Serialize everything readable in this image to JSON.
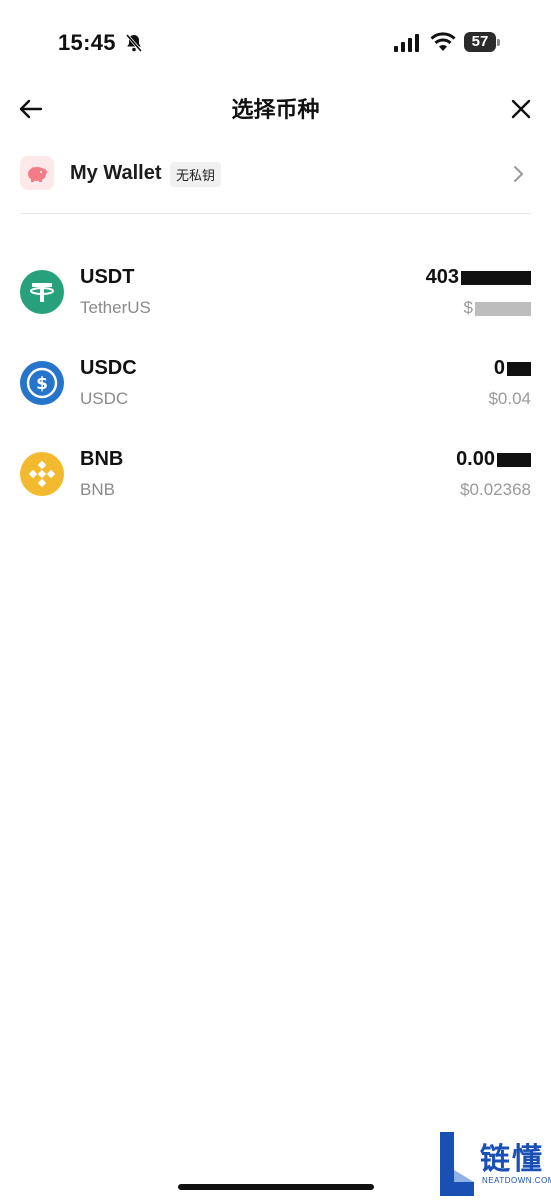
{
  "status_bar": {
    "time": "15:45",
    "battery": "57",
    "icons": [
      "bell-slash-icon",
      "signal-icon",
      "wifi-icon",
      "battery-icon"
    ]
  },
  "nav": {
    "title": "选择币种",
    "back_icon": "arrow-left-icon",
    "close_icon": "close-icon"
  },
  "wallet": {
    "name": "My Wallet",
    "badge": "无私钥",
    "icon": "piggy-bank-icon",
    "accent": "#f47c86"
  },
  "tokens": [
    {
      "symbol": "USDT",
      "name": "TetherUS",
      "balance": "403",
      "usd_value": "$",
      "color": "#26a17b",
      "icon": "tether-icon"
    },
    {
      "symbol": "USDC",
      "name": "USDC",
      "balance": "0",
      "usd_value": "$0.04",
      "color": "#2775ca",
      "icon": "usdc-icon"
    },
    {
      "symbol": "BNB",
      "name": "BNB",
      "balance": "0.00",
      "usd_value": "$0.02368",
      "color": "#f3ba2f",
      "icon": "bnb-icon"
    }
  ],
  "watermark": {
    "text": "链懂",
    "sub": "NEATDOWN.COM"
  }
}
